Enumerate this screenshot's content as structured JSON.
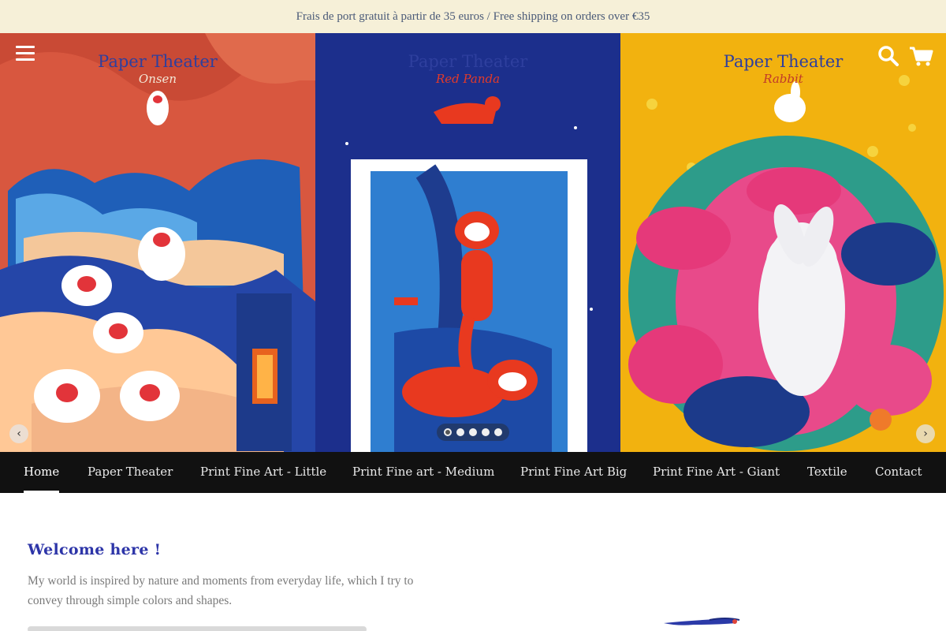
{
  "announcement": "Frais de port gratuit à partir de 35 euros / Free shipping on orders over €35",
  "header": {
    "menu_icon": "hamburger-menu-icon",
    "search_icon": "search-icon",
    "cart_icon": "cart-icon"
  },
  "slideshow": {
    "panels": [
      {
        "title": "Paper Theater",
        "subtitle": "Onsen",
        "subtitle_color": "#f3e7d6"
      },
      {
        "title": "Paper Theater",
        "subtitle": "Red Panda",
        "subtitle_color": "#e23a2a"
      },
      {
        "title": "Paper Theater",
        "subtitle": "Rabbit",
        "subtitle_color": "#c0392b"
      }
    ],
    "prev_icon": "chevron-left-icon",
    "next_icon": "chevron-right-icon",
    "prev_glyph": "‹",
    "next_glyph": "›",
    "dot_count": 5,
    "active_dot": 1
  },
  "nav": {
    "items": [
      {
        "label": "Home",
        "active": true
      },
      {
        "label": "Paper Theater"
      },
      {
        "label": "Print Fine Art - Little"
      },
      {
        "label": "Print Fine art - Medium"
      },
      {
        "label": "Print Fine Art Big"
      },
      {
        "label": "Print Fine Art - Giant"
      },
      {
        "label": "Textile"
      },
      {
        "label": "Contact"
      }
    ]
  },
  "main": {
    "welcome_title": "Welcome here !",
    "welcome_text": "My world is inspired by nature and moments from everyday life, which I try to convey through simple colors and shapes."
  },
  "colors": {
    "announcement_bg": "#f6f0d8",
    "nav_bg": "#111111",
    "accent_blue": "#2d35a8"
  }
}
